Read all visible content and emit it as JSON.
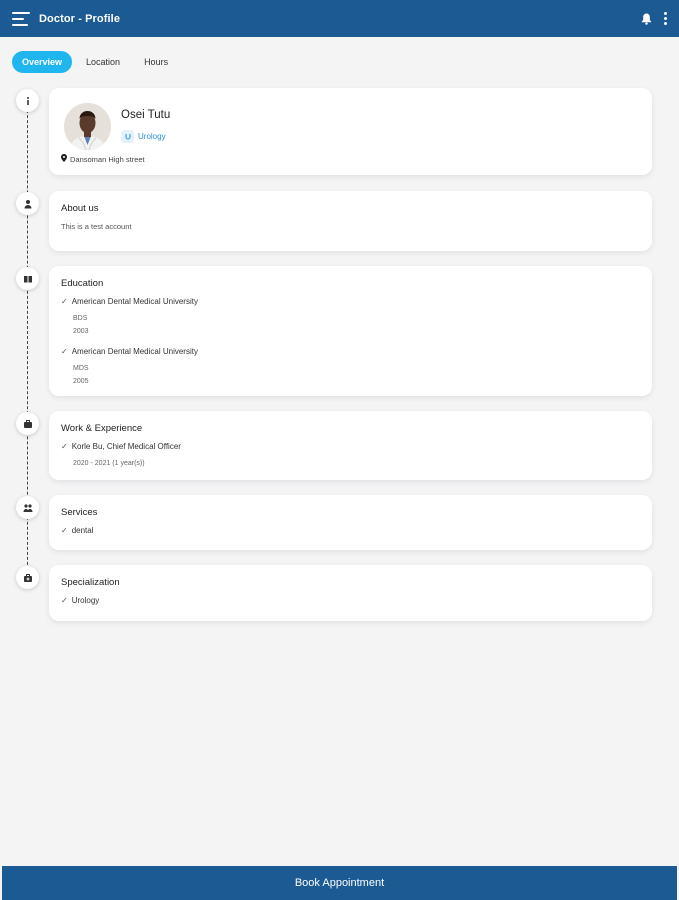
{
  "appbar": {
    "title": "Doctor - Profile"
  },
  "tabs": [
    {
      "label": "Overview",
      "active": true
    },
    {
      "label": "Location",
      "active": false
    },
    {
      "label": "Hours",
      "active": false
    }
  ],
  "profile": {
    "name": "Osei Tutu",
    "specialty": "Urology",
    "address": "Dansoman High street"
  },
  "about": {
    "title": "About us",
    "text": "This is a test account"
  },
  "education": {
    "title": "Education",
    "items": [
      {
        "school": "American Dental Medical University",
        "degree": "BDS",
        "year": "2003"
      },
      {
        "school": "American Dental Medical University",
        "degree": "MDS",
        "year": "2005"
      }
    ]
  },
  "work": {
    "title": "Work & Experience",
    "items": [
      {
        "role": "Korle Bu, Chief Medical Officer",
        "period": "2020 - 2021 (1 year(s))"
      }
    ]
  },
  "services": {
    "title": "Services",
    "items": [
      "dental"
    ]
  },
  "specialization": {
    "title": "Specialization",
    "items": [
      "Urology"
    ]
  },
  "footer": {
    "book_label": "Book Appointment"
  },
  "colors": {
    "primary": "#1b5a93",
    "accent": "#1fb6ef",
    "background": "#f4f4f5"
  }
}
